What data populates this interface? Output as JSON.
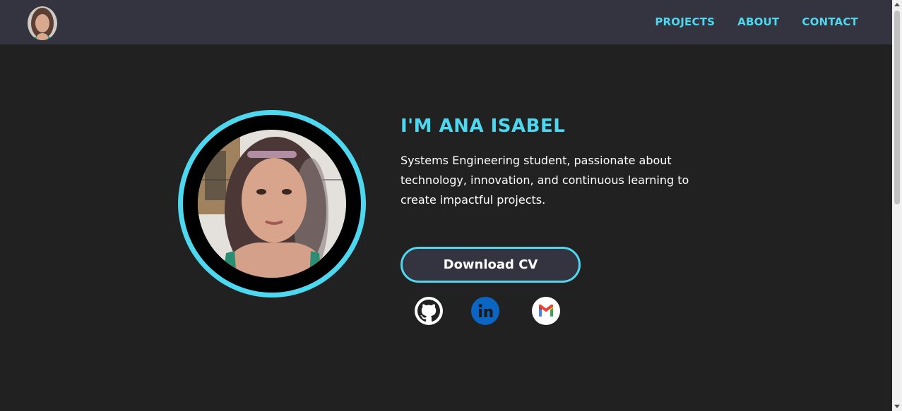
{
  "nav": {
    "links": [
      "PROJECTS",
      "ABOUT",
      "CONTACT"
    ]
  },
  "hero": {
    "title": "I'M ANA ISABEL",
    "description": "Systems Engineering student, passionate about technology, innovation, and continuous learning to create impactful projects.",
    "cv_button": "Download CV"
  },
  "social": [
    "github-icon",
    "linkedin-icon",
    "gmail-icon"
  ],
  "colors": {
    "accent": "#4dd8f0",
    "background": "#212121",
    "navbar": "#343440",
    "button": "#343440",
    "text": "#ffffff",
    "linkedin": "#0a66c2"
  }
}
